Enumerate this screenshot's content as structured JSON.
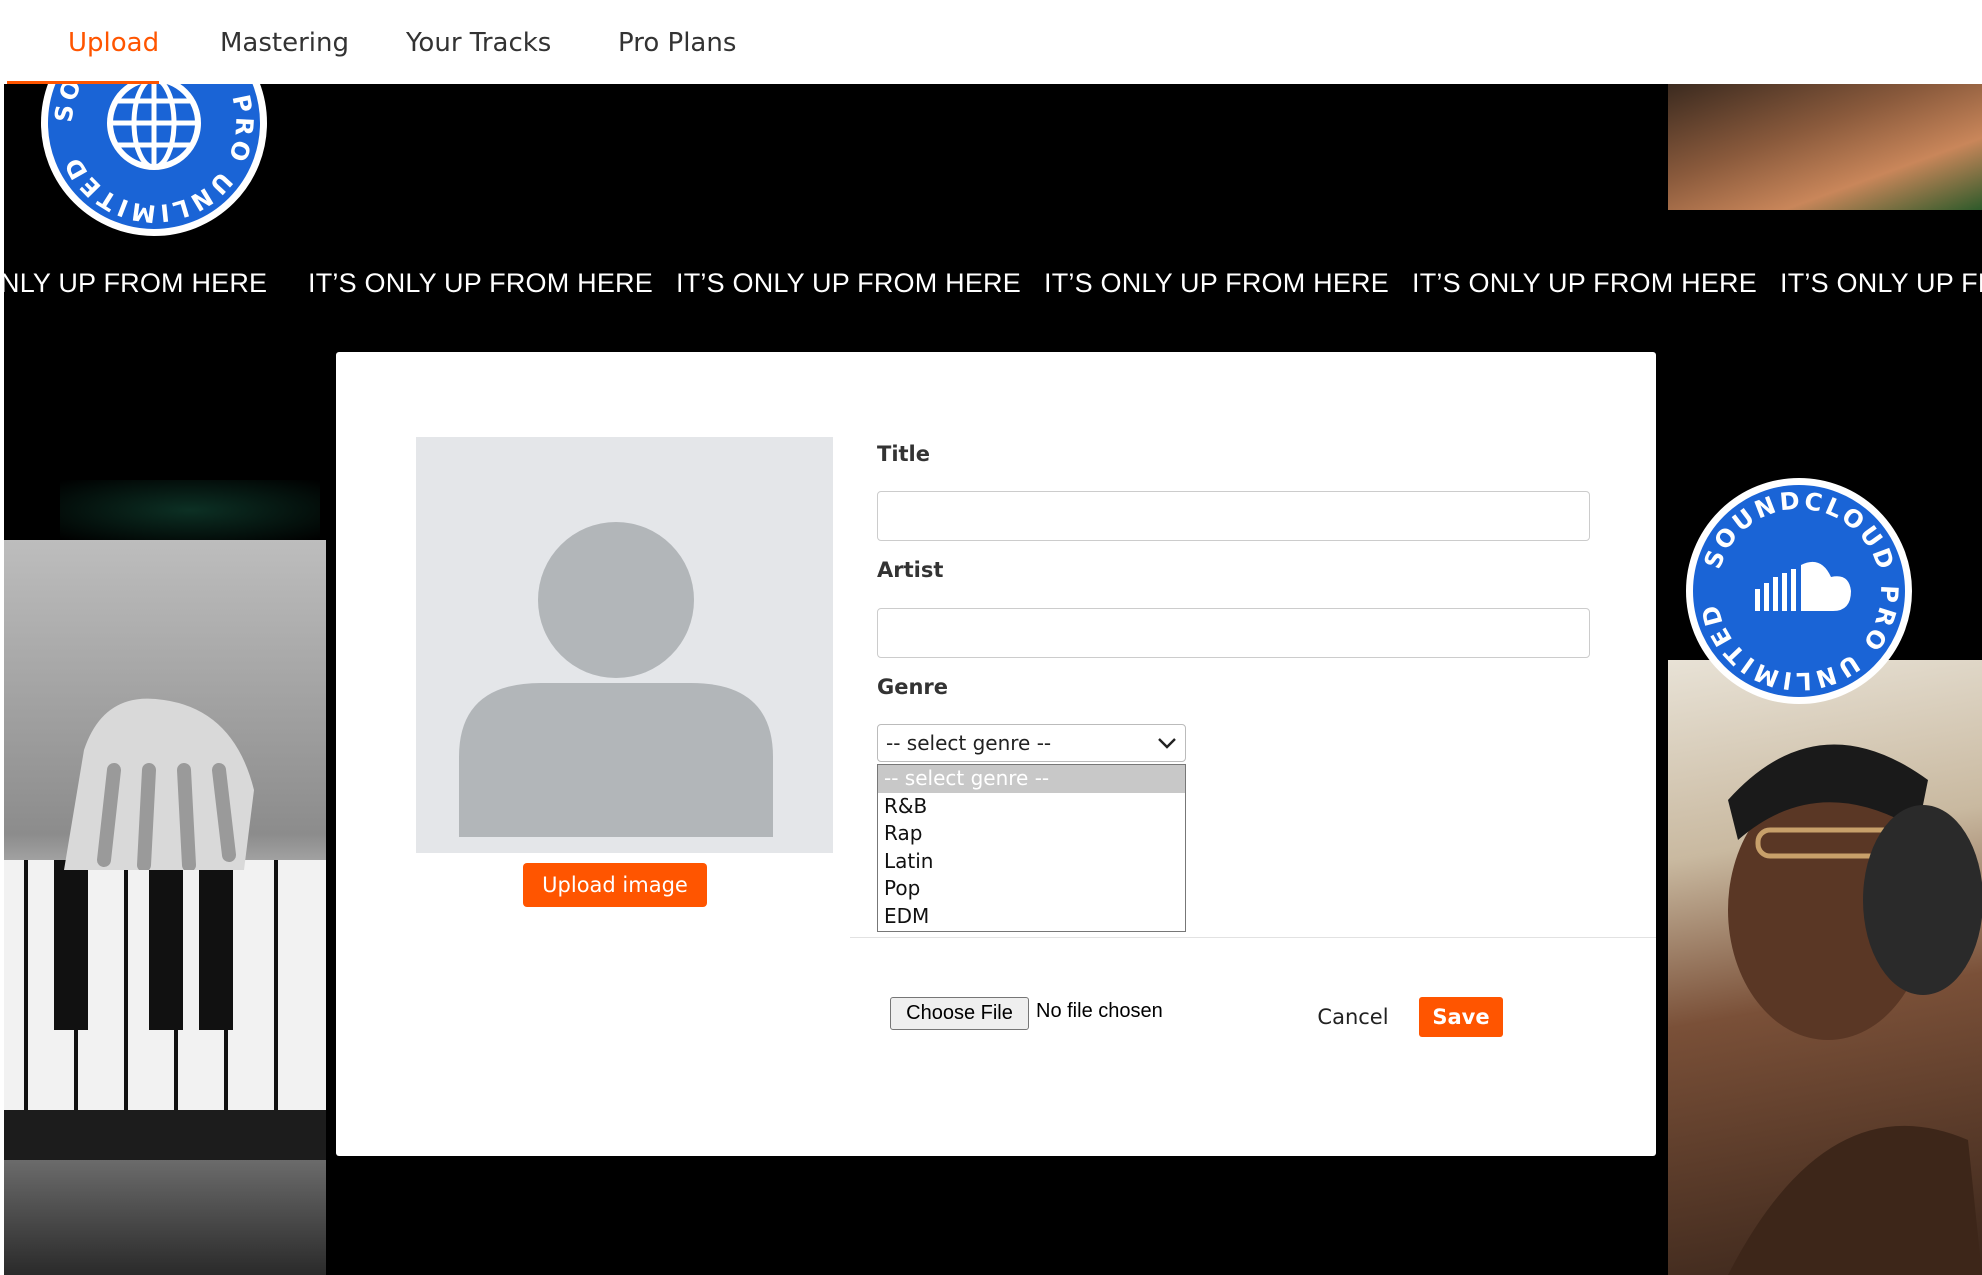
{
  "nav": {
    "tabs": [
      {
        "label": "Upload",
        "active": true
      },
      {
        "label": "Mastering",
        "active": false
      },
      {
        "label": "Your Tracks",
        "active": false
      },
      {
        "label": "Pro Plans",
        "active": false
      }
    ]
  },
  "badges": {
    "top_left_text": "SOUNDCLOUD PRO UNLIMITED",
    "top_left_icon": "globe-icon",
    "right_text": "SOUNDCLOUD PRO UNLIMITED",
    "right_icon": "soundcloud-cloud-icon"
  },
  "ticker": {
    "items": [
      "NLY UP FROM HERE",
      "IT’S ONLY UP FROM HERE",
      "IT’S ONLY UP FROM HERE",
      "IT’S ONLY UP FROM HERE",
      "IT’S ONLY UP FROM HERE",
      "IT’S ONLY UP FR"
    ]
  },
  "form": {
    "upload_image_label": "Upload image",
    "title_label": "Title",
    "title_value": "",
    "artist_label": "Artist",
    "artist_value": "",
    "genre_label": "Genre",
    "genre_selected": "-- select genre --",
    "genre_options": [
      "-- select genre --",
      "R&B",
      "Rap",
      "Latin",
      "Pop",
      "EDM"
    ],
    "choose_file_label": "Choose File",
    "file_status": "No file chosen",
    "cancel_label": "Cancel",
    "save_label": "Save"
  },
  "colors": {
    "accent": "#ff5500",
    "badge_blue": "#1a64d6",
    "background": "#000000"
  }
}
